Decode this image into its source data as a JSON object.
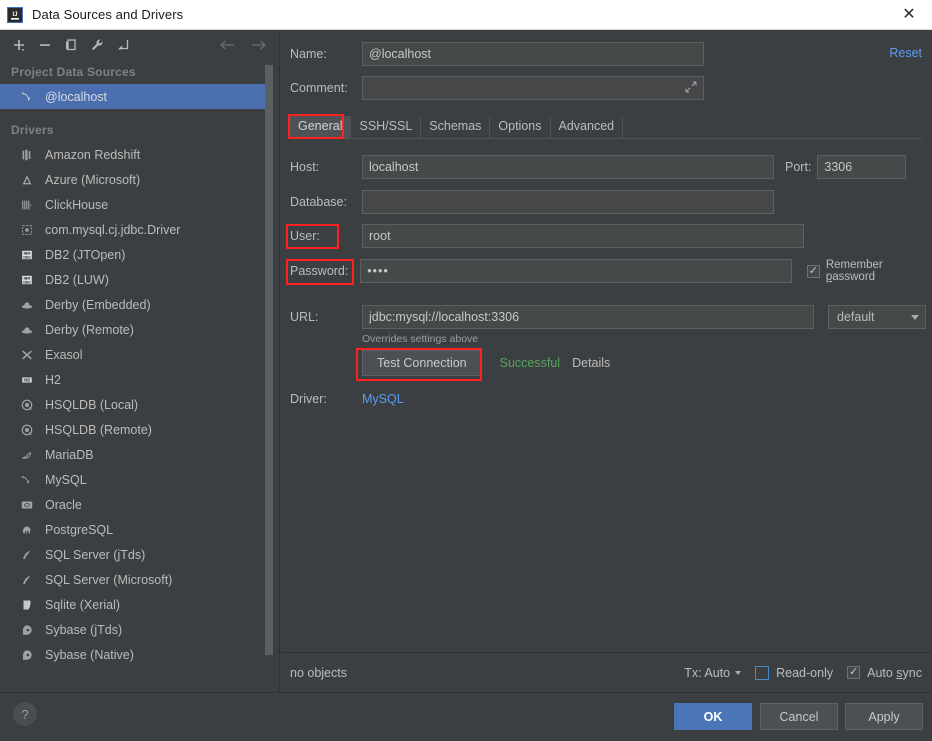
{
  "window": {
    "title": "Data Sources and Drivers",
    "app_icon": "intellij-idea-icon",
    "close_label": "✕"
  },
  "sidebar": {
    "toolbar": [
      {
        "name": "add-button",
        "glyph": "+"
      },
      {
        "name": "remove-button",
        "glyph": "−"
      },
      {
        "name": "duplicate-button",
        "glyph": "copy"
      },
      {
        "name": "properties-button",
        "glyph": "wrench"
      },
      {
        "name": "import-button",
        "glyph": "arrow-corner"
      }
    ],
    "nav": [
      {
        "name": "back-button",
        "glyph": "←"
      },
      {
        "name": "forward-button",
        "glyph": "→"
      }
    ],
    "project_group_label": "Project Data Sources",
    "data_sources": [
      {
        "label": "@localhost",
        "icon": "mysql-dolphin-icon",
        "selected": true
      }
    ],
    "drivers_group_label": "Drivers",
    "drivers": [
      {
        "label": "Amazon Redshift",
        "icon": "redshift-icon"
      },
      {
        "label": "Azure (Microsoft)",
        "icon": "azure-icon"
      },
      {
        "label": "ClickHouse",
        "icon": "clickhouse-icon"
      },
      {
        "label": "com.mysql.cj.jdbc.Driver",
        "icon": "generic-driver-icon"
      },
      {
        "label": "DB2 (JTOpen)",
        "icon": "db2-icon"
      },
      {
        "label": "DB2 (LUW)",
        "icon": "db2-icon"
      },
      {
        "label": "Derby (Embedded)",
        "icon": "derby-hat-icon"
      },
      {
        "label": "Derby (Remote)",
        "icon": "derby-hat-icon"
      },
      {
        "label": "Exasol",
        "icon": "exasol-icon"
      },
      {
        "label": "H2",
        "icon": "h2-icon"
      },
      {
        "label": "HSQLDB (Local)",
        "icon": "hsqldb-icon"
      },
      {
        "label": "HSQLDB (Remote)",
        "icon": "hsqldb-icon"
      },
      {
        "label": "MariaDB",
        "icon": "mariadb-seal-icon"
      },
      {
        "label": "MySQL",
        "icon": "mysql-dolphin-icon"
      },
      {
        "label": "Oracle",
        "icon": "oracle-icon"
      },
      {
        "label": "PostgreSQL",
        "icon": "postgresql-elephant-icon"
      },
      {
        "label": "SQL Server (jTds)",
        "icon": "sqlserver-icon"
      },
      {
        "label": "SQL Server (Microsoft)",
        "icon": "sqlserver-icon"
      },
      {
        "label": "Sqlite (Xerial)",
        "icon": "sqlite-icon"
      },
      {
        "label": "Sybase (jTds)",
        "icon": "sybase-icon"
      },
      {
        "label": "Sybase (Native)",
        "icon": "sybase-icon"
      }
    ]
  },
  "form": {
    "name_label": "Name:",
    "name_value": "@localhost",
    "comment_label": "Comment:",
    "comment_value": "",
    "comment_expand_icon": "expand-icon",
    "reset_label": "Reset",
    "tabs": [
      {
        "label": "General",
        "active": true
      },
      {
        "label": "SSH/SSL",
        "active": false
      },
      {
        "label": "Schemas",
        "active": false
      },
      {
        "label": "Options",
        "active": false
      },
      {
        "label": "Advanced",
        "active": false
      }
    ],
    "host_label": "Host:",
    "host_value": "localhost",
    "port_label": "Port:",
    "port_value": "3306",
    "database_label": "Database:",
    "database_value": "",
    "user_label": "User:",
    "user_value": "root",
    "password_label": "Password:",
    "password_value": "••••",
    "remember_password_label": "Remember password",
    "remember_password_checked": true,
    "url_label": "URL:",
    "url_value": "jdbc:mysql://localhost:3306",
    "url_mode": "default",
    "overrides_hint": "Overrides settings above",
    "test_connection_label": "Test Connection",
    "test_status": "Successful",
    "test_details_label": "Details",
    "driver_label": "Driver:",
    "driver_value": "MySQL"
  },
  "status": {
    "objects_text": "no objects",
    "tx_label": "Tx: Auto",
    "readonly_label": "Read-only",
    "readonly_checked": false,
    "autosync_label": "Auto sync",
    "autosync_checked": true
  },
  "footer": {
    "help_label": "?",
    "ok_label": "OK",
    "cancel_label": "Cancel",
    "apply_label": "Apply"
  },
  "colors": {
    "background": "#3c3f41",
    "selection": "#4b6eaf",
    "accent_link": "#589df6",
    "success": "#58a65c",
    "annotation": "#ff2020",
    "primary_button": "#4a76b8"
  }
}
